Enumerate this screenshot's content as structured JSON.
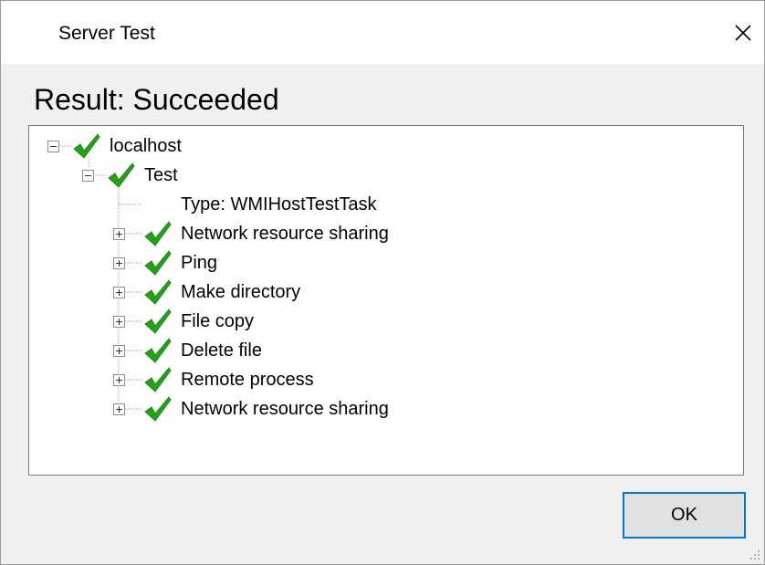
{
  "window": {
    "title": "Server Test",
    "close_icon": "close-icon"
  },
  "result": {
    "heading": "Result: Succeeded"
  },
  "tree": {
    "root": {
      "label": "localhost",
      "expanded": true,
      "status": "success",
      "icon": "check-icon"
    },
    "test": {
      "label": "Test",
      "expanded": true,
      "status": "success",
      "icon": "check-icon"
    },
    "type_line": "Type: WMIHostTestTask",
    "items": [
      {
        "label": "Network resource sharing",
        "status": "success",
        "expanded": false
      },
      {
        "label": "Ping",
        "status": "success",
        "expanded": false
      },
      {
        "label": "Make directory",
        "status": "success",
        "expanded": false
      },
      {
        "label": "File copy",
        "status": "success",
        "expanded": false
      },
      {
        "label": "Delete file",
        "status": "success",
        "expanded": false
      },
      {
        "label": "Remote process",
        "status": "success",
        "expanded": false
      },
      {
        "label": "Network resource sharing",
        "status": "success",
        "expanded": false
      }
    ]
  },
  "footer": {
    "ok_label": "OK"
  },
  "colors": {
    "check": "#22a316",
    "accent_border": "#0078d7"
  }
}
